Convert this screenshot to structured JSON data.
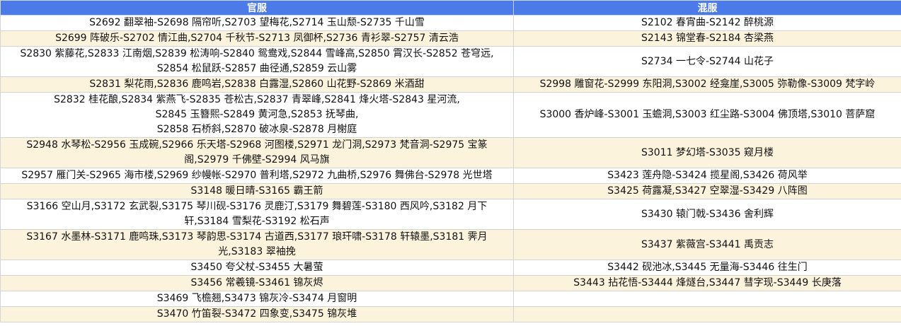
{
  "headers": {
    "official": "官服",
    "mixed": "混服"
  },
  "rows": [
    {
      "official": [
        "S2692 翻翠袖-S2698 隔帘听,S2703 望梅花,S2714 玉山颓-S2735 千山雪"
      ],
      "mixed": [
        "S2102 春宵曲-S2142 醉桃源"
      ]
    },
    {
      "official": [
        "S2699 阵破乐-S2702 情江曲,S2704 千秋节-S2713 凤御杯,S2736 青衫翠-S2757 清云浩"
      ],
      "mixed": [
        "S2143 锦堂春-S2184 杏梁燕"
      ]
    },
    {
      "official": [
        "S2830 紫藤花,S2833 江南烟,S2839 松涛响-S2840 鸳鸯戏,S2844 雪峰高,S2850 霄汉长-S2852 苍穹远,",
        "S2854 松鼠跃-S2857 曲径通,S2859 云山雾"
      ],
      "mixed": [
        "S2734 一七令-S2744 山花子"
      ]
    },
    {
      "official": [
        "S2831 梨花雨,S2836 鹿鸣岩,S2838 白露湿,S2860 山花野-S2869 米酒甜"
      ],
      "mixed": [
        "S2998 雕窗花-S2999 东阳洞,S3002 经龛崖,S3005 弥勒像-S3009 梵字岭"
      ]
    },
    {
      "official": [
        "S2832 桂花酿,S2834 紫燕飞-S2835 苍松古,S2837 青翠峰,S2841 烽火塔-S2843 星河流,",
        "S2845 玉簪熙-S2849 黄河急,S2853 抚琴曲,",
        "S2858 石桥斜,S2870 破冰泉-S2878 月榭庭"
      ],
      "mixed": [
        "S3000 香炉峰-S3001 玉蟾洞,S3003 红尘路-S3004 佛顶塔,S3010 菩萨窟"
      ]
    },
    {
      "official": [
        "S2948 水琴松-S2956 玉成碗,S2966 乐天塔-S2968 河图楼,S2971 龙门洞,S2973 梵音洞-S2975 宝篆",
        "阁,S2979 千佛壁-S2994 风马旗"
      ],
      "mixed": [
        "S3011 梦幻塔-S3035 窥月楼"
      ]
    },
    {
      "official": [
        "S2957 雁门关-S2965 海市楼,S2969 纱幔帐-S2970 普利塔,S2972 九曲桥,S2976 舞佛台-S2978 光世塔"
      ],
      "mixed": [
        "S3423 莲舟隐-S3424 揽星阁,S3426 荷风举"
      ]
    },
    {
      "official": [
        "S3148 暖日晴-S3165 霸王箭"
      ],
      "mixed": [
        "S3425 荷露凝,S3427 空翠湿-S3429 八阵图"
      ]
    },
    {
      "official": [
        "S3166 空山月,S3172 玄武裂,S3175 琴川砚-S3176 灵鹿汀,S3179 舞碧莲-S3180 西风吟,S3182 月下",
        "轩,S3184 雪梨花-S3192 松石声"
      ],
      "mixed": [
        "S3430 辕门戟-S3436 舍利辉"
      ]
    },
    {
      "official": [
        "S3167 水墨林-S3171 鹿鸣珠,S3173 琴韵思-S3174 古道西,S3177 琅玕啸-S3178 轩辕墨,S3181 霁月",
        "光,S3183 翠袖挽"
      ],
      "mixed": [
        "S3437 紫薇宫-S3441 禹贡志"
      ]
    },
    {
      "official": [
        "S3450 夸父杖-S3455 大暑萤"
      ],
      "mixed": [
        "S3442 砚池冰,S3445 无量海-S3446 往生门"
      ]
    },
    {
      "official": [
        "S3456 常羲镜-S3461 锦灰烬"
      ],
      "mixed": [
        "S3443 拈花悟-S3444 烽燧台,S3447 彗字现-S3449 长庚落"
      ]
    },
    {
      "official": [
        "S3469 飞檐翘,S3473 锦灰冷-S3474 月窗明"
      ],
      "mixed": []
    },
    {
      "official": [
        "S3470 竹笛裂-S3472 四象变,S3475 锦灰堆"
      ],
      "mixed": []
    }
  ]
}
